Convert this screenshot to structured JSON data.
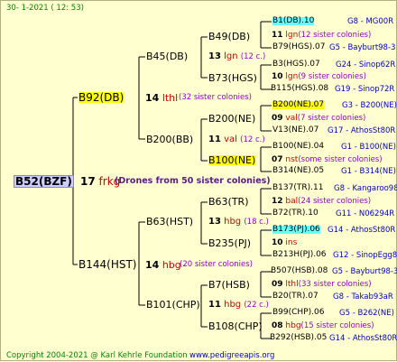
{
  "header": {
    "date": "30-   1-2021  ( 12: 53)"
  },
  "footer": {
    "copyright": "Copyright 2004-2021 @ Karl Kehrle Foundation",
    "site": "www.pedigreeapis.org"
  },
  "root": {
    "id": "B52(BZF)",
    "num": "17",
    "line": "frkg",
    "note": "(Drones from 50 sister colonies)"
  },
  "gen1": [
    {
      "id": "B92(DB)",
      "num": "14",
      "line": "lthl",
      "note": "(32 sister colonies)"
    },
    {
      "id": "B144(HST)",
      "num": "14",
      "line": "hbg",
      "note": "(20 sister colonies)"
    }
  ],
  "gen2": [
    {
      "id": "B45(DB)",
      "num": "13",
      "line": "lgn",
      "note": "(12 c.)"
    },
    {
      "id": "B200(BB)",
      "num": "11",
      "line": "val",
      "note": "(12 c.)"
    },
    {
      "id": "B63(HST)",
      "num": "13",
      "line": "hbg",
      "note": "(18 c.)"
    },
    {
      "id": "B101(CHP)",
      "num": "11",
      "line": "hbg",
      "note": "(22 c.)"
    }
  ],
  "gen3": [
    {
      "id": "B49(DB)",
      "num": "11",
      "line": "lgn",
      "note": "(12 sister colonies)"
    },
    {
      "id": "B73(HGS)",
      "num": "10",
      "line": "lgn",
      "note": "(9 sister colonies)"
    },
    {
      "id": "B200(NE)",
      "num": "09",
      "line": "val",
      "note": "(7 sister colonies)"
    },
    {
      "id": "B100(NE)",
      "num": "07",
      "line": "nst",
      "note": "(some sister colonies)"
    },
    {
      "id": "B63(TR)",
      "num": "12",
      "line": "bal",
      "note": "(24 sister colonies)"
    },
    {
      "id": "B235(PJ)",
      "num": "10",
      "line": "ins",
      "note": ""
    },
    {
      "id": "B7(HSB)",
      "num": "09",
      "line": "lthl",
      "note": "(33 sister colonies)"
    },
    {
      "id": "B108(CHP)",
      "num": "08",
      "line": "hbg",
      "note": "(15 sister colonies)"
    }
  ],
  "gen4": [
    {
      "id": "B1(DB).10",
      "code": "G8 - MG00R"
    },
    {
      "id": "B79(HGS).07",
      "code": "G5 - Bayburt98-3"
    },
    {
      "id": "B3(HGS).07",
      "code": "G24 - Sinop62R"
    },
    {
      "id": "B115(HGS).08",
      "code": "G19 - Sinop72R"
    },
    {
      "id": "B200(NE).07",
      "code": "G3 - B200(NE)"
    },
    {
      "id": "V13(NE).07",
      "code": "G17 - AthosSt80R"
    },
    {
      "id": "B100(NE).04",
      "code": "G1 - B100(NE)"
    },
    {
      "id": "B314(NE).05",
      "code": "G1 - B314(NE)"
    },
    {
      "id": "B137(TR).11",
      "code": "G8 - Kangaroo98R"
    },
    {
      "id": "B72(TR).10",
      "code": "G11 - N06294R"
    },
    {
      "id": "B173(PJ).06",
      "code": "G14 - AthosSt80R"
    },
    {
      "id": "B213H(PJ).06",
      "code": "G12 - SinopEgg86R"
    },
    {
      "id": "B507(HSB).08",
      "code": "G5 - Bayburt98-3"
    },
    {
      "id": "B20(TR).07",
      "code": "G8 - Takab93aR"
    },
    {
      "id": "B99(CHP).06",
      "code": "G5 - B262(NE)"
    },
    {
      "id": "B292(HSB).05",
      "code": "G14 - AthosSt80R"
    }
  ]
}
